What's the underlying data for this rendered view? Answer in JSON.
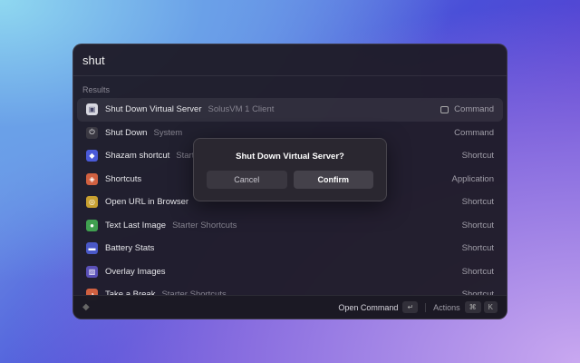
{
  "search": {
    "value": "shut"
  },
  "section_label": "Results",
  "items": [
    {
      "title": "Shut Down Virtual Server",
      "subtitle": "SolusVM 1 Client",
      "type": "Command",
      "icon": "server-icon",
      "color": "#d8d8e0",
      "selected": true
    },
    {
      "title": "Shut Down",
      "subtitle": "System",
      "type": "Command",
      "icon": "power-icon",
      "color": "#3a3842"
    },
    {
      "title": "Shazam shortcut",
      "subtitle": "Starter Shortcuts",
      "type": "Shortcut",
      "icon": "shazam-icon",
      "color": "#4a5ad8"
    },
    {
      "title": "Shortcuts",
      "subtitle": "",
      "type": "Application",
      "icon": "shortcuts-icon",
      "color": "#d06040"
    },
    {
      "title": "Open URL in Browser",
      "subtitle": "",
      "type": "Shortcut",
      "icon": "safari-icon",
      "color": "#c8a030"
    },
    {
      "title": "Text Last Image",
      "subtitle": "Starter Shortcuts",
      "type": "Shortcut",
      "icon": "message-icon",
      "color": "#40a050"
    },
    {
      "title": "Battery Stats",
      "subtitle": "",
      "type": "Shortcut",
      "icon": "battery-icon",
      "color": "#4a58c8"
    },
    {
      "title": "Overlay Images",
      "subtitle": "",
      "type": "Shortcut",
      "icon": "image-icon",
      "color": "#5a50b8"
    },
    {
      "title": "Take a Break",
      "subtitle": "Starter Shortcuts",
      "type": "Shortcut",
      "icon": "timer-icon",
      "color": "#d06040"
    }
  ],
  "footer": {
    "primary_action": "Open Command",
    "primary_key": "↵",
    "actions_label": "Actions",
    "actions_keys": [
      "⌘",
      "K"
    ]
  },
  "dialog": {
    "title": "Shut Down Virtual Server?",
    "cancel": "Cancel",
    "confirm": "Confirm"
  }
}
